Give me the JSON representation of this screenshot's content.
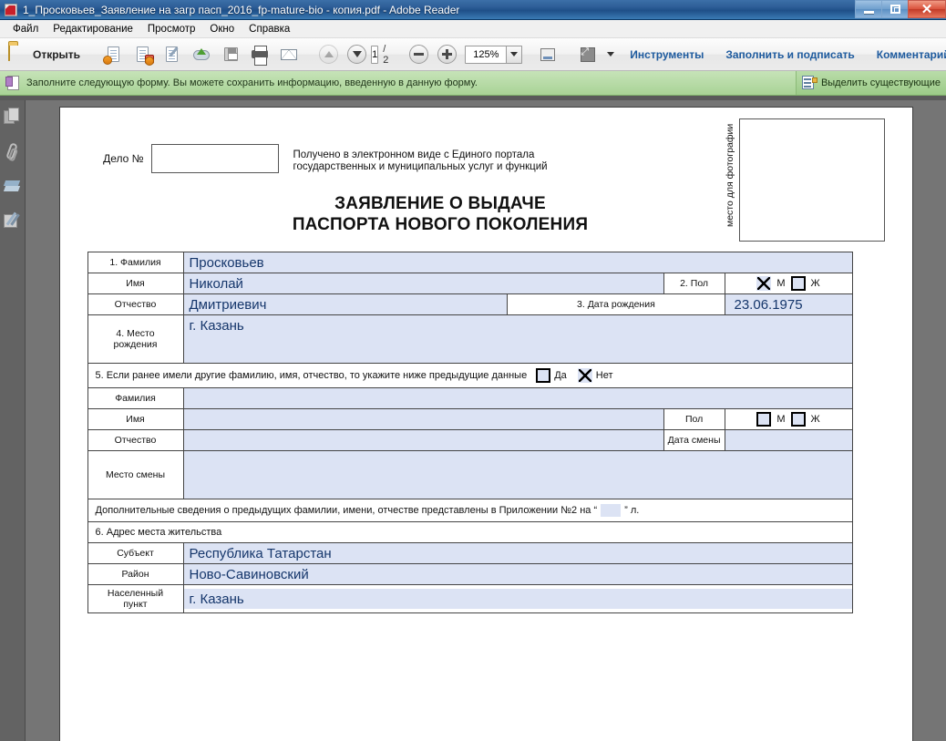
{
  "window": {
    "title": "1_Просковьев_Заявление на загр пасп_2016_fp-mature-bio - копия.pdf - Adobe Reader",
    "minimize": "—",
    "restore": "❐",
    "close": "✕"
  },
  "menu": {
    "items": [
      "Файл",
      "Редактирование",
      "Просмотр",
      "Окно",
      "Справка"
    ]
  },
  "toolbar": {
    "open_label": "Открыть",
    "page_current": "1",
    "page_total": "/ 2",
    "zoom_value": "125%",
    "links": [
      "Инструменты",
      "Заполнить и подписать",
      "Комментарий"
    ]
  },
  "message_bar": {
    "text": "Заполните следующую форму. Вы можете сохранить информацию, введенную в данную форму.",
    "button_label": "Выделить существующие"
  },
  "document": {
    "case_label": "Дело №",
    "case_value": "",
    "portal_note": "Получено в электронном виде с Единого портала государственных и муниципальных услуг и функций",
    "photo_label": "место для фотографии",
    "title_line1": "ЗАЯВЛЕНИЕ О ВЫДАЧЕ",
    "title_line2": "ПАСПОРТА НОВОГО ПОКОЛЕНИЯ",
    "rows": {
      "surname_label": "1. Фамилия",
      "surname_value": "Просковьев",
      "name_label": "Имя",
      "name_value": "Николай",
      "sex_label": "2. Пол",
      "sex_m": "М",
      "sex_f": "Ж",
      "patronymic_label": "Отчество",
      "patronymic_value": "Дмитриевич",
      "birthdate_label": "3. Дата рождения",
      "birthdate_value": "23.06.1975",
      "birthplace_label_l1": "4. Место",
      "birthplace_label_l2": "рождения",
      "birthplace_value": "г. Казань",
      "prev_names_question": "5. Если ранее имели другие фамилию, имя, отчество, то укажите ниже предыдущие данные",
      "yes_label": "Да",
      "no_label": "Нет",
      "prev_surname_label": "Фамилия",
      "prev_surname_value": "",
      "prev_name_label": "Имя",
      "prev_name_value": "",
      "prev_sex_label": "Пол",
      "prev_sex_m": "М",
      "prev_sex_f": "Ж",
      "prev_patronymic_label": "Отчество",
      "prev_patronymic_value": "",
      "change_date_label": "Дата смены",
      "change_date_value": "",
      "change_place_label": "Место смены",
      "change_place_value": "",
      "appendix_note_pre": "Дополнительные сведения о предыдущих фамилии, имени, отчестве представлены в Приложении №2 на “",
      "appendix_value": "",
      "appendix_note_post": "” л.",
      "address_section_label": "6. Адрес места жительства",
      "subject_label": "Субъект",
      "subject_value": "Республика Татарстан",
      "district_label": "Район",
      "district_value": "Ново-Савиновский",
      "locality_label_l1": "Населенный",
      "locality_label_l2": "пункт",
      "locality_value": "г. Казань"
    }
  },
  "navpane": {
    "icons": [
      "page-thumbnails-icon",
      "attachments-icon",
      "layers-icon",
      "signatures-icon"
    ]
  }
}
